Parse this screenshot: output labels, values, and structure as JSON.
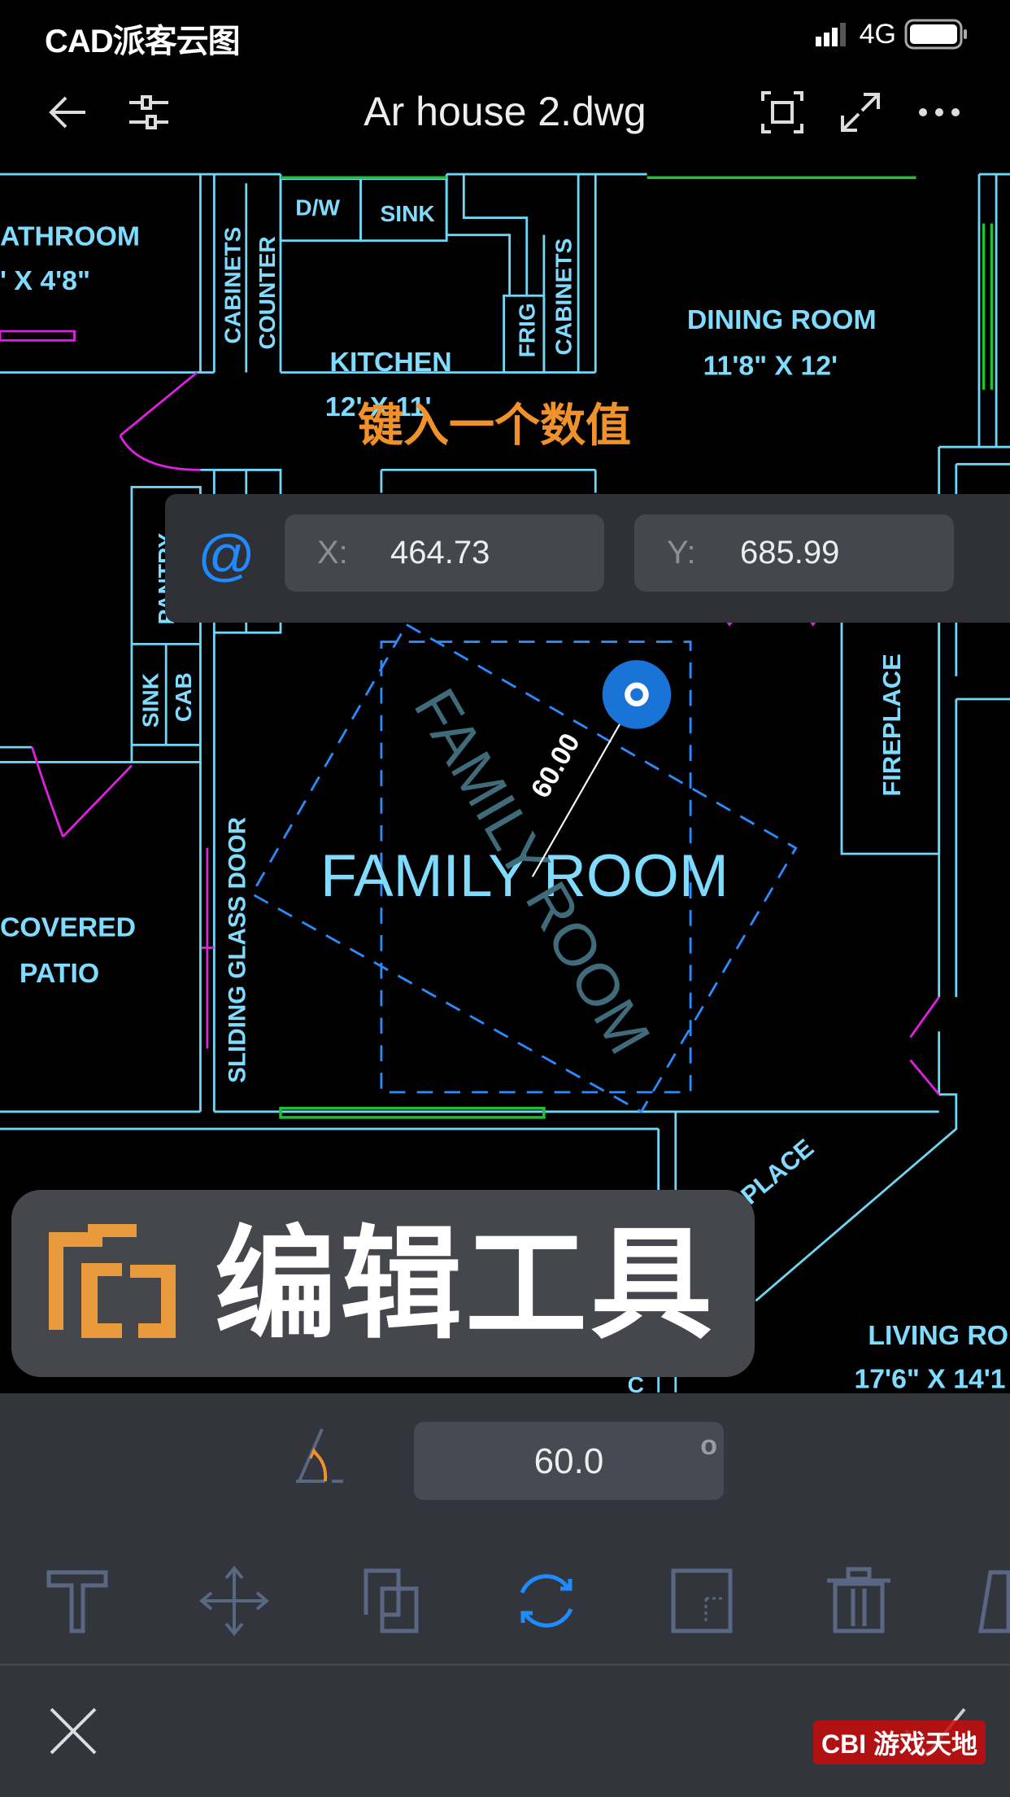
{
  "status_bar": {
    "brand": "CAD派客云图",
    "network": "4G",
    "battery_level": 1.0
  },
  "header": {
    "title": "Ar house 2.dwg",
    "icons": [
      "back-arrow-icon",
      "layers-settings-icon",
      "zoom-extents-icon",
      "fullscreen-icon",
      "more-icon"
    ]
  },
  "hint": "键入一个数值",
  "coordinate_input": {
    "mode_symbol": "@",
    "x_label": "X:",
    "x_value": "464.73",
    "y_label": "Y:",
    "y_value": "685.99"
  },
  "drawing": {
    "labels": [
      "ATHROOM",
      "' X 4'8\"",
      "CABINETS",
      "COUNTER",
      "D/W",
      "SINK",
      "FRIG",
      "CABINETS",
      "KITCHEN",
      "12' X 11'",
      "DINING ROOM",
      "11'8\" X 12'",
      "PANTRY",
      "SINK",
      "CAB",
      "FIREPLACE",
      "SLIDING GLASS DOOR",
      "COVERED",
      "PATIO",
      "FAMILY ROOM",
      "LIVING RO",
      "17'6\" X 14'1",
      "PLACE",
      "C"
    ],
    "rotated_preview_text": "FAMILY ROOM",
    "rotation_readout": "60.00"
  },
  "edit_badge": {
    "text": "编辑工具"
  },
  "bottom_panel": {
    "angle_value": "60.0",
    "angle_unit": "o",
    "tools": [
      "text-tool",
      "move-tool",
      "copy-tool",
      "rotate-tool",
      "scale-tool",
      "delete-tool",
      "mirror-tool"
    ],
    "active_tool": "rotate-tool"
  },
  "colors": {
    "plan_lines": "#6fd6f5",
    "accent_blue": "#1f8bff",
    "hint_orange": "#f0922b",
    "panel_bg": "#33353d",
    "magenta": "#e020e0",
    "green": "#22c033"
  },
  "watermark": "CBI 游戏天地"
}
